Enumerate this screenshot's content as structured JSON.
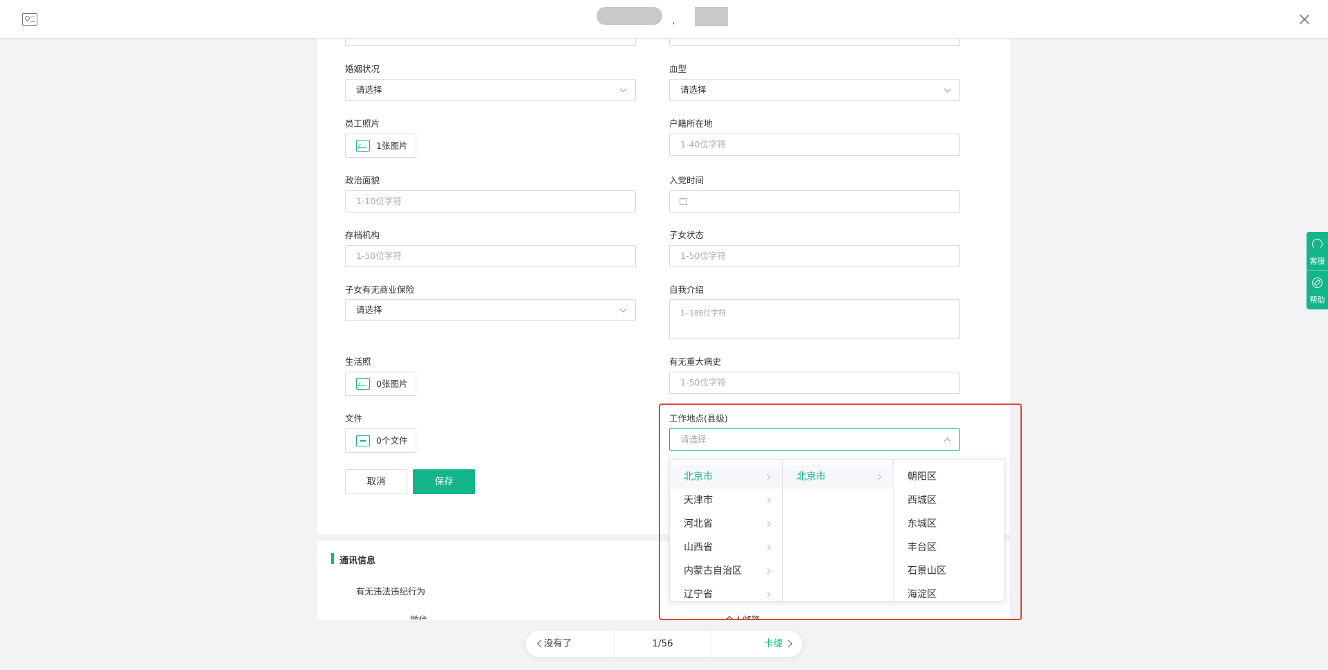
{
  "header": {
    "separator": ","
  },
  "form": {
    "marital": {
      "label": "婚姻状况",
      "value": "请选择"
    },
    "blood": {
      "label": "血型",
      "value": "请选择"
    },
    "photo": {
      "label": "员工照片",
      "count": "1张图片"
    },
    "hukou": {
      "label": "户籍所在地",
      "placeholder": "1-40位字符"
    },
    "political": {
      "label": "政治面貌",
      "placeholder": "1-10位字符"
    },
    "party_date": {
      "label": "入党时间"
    },
    "archive": {
      "label": "存档机构",
      "placeholder": "1-50位字符"
    },
    "children_status": {
      "label": "子女状态",
      "placeholder": "1-50位字符"
    },
    "children_insurance": {
      "label": "子女有无商业保险",
      "value": "请选择"
    },
    "intro": {
      "label": "自我介绍",
      "placeholder": "1~100位字符"
    },
    "life_photo": {
      "label": "生活照",
      "count": "0张图片"
    },
    "illness": {
      "label": "有无重大病史",
      "placeholder": "1-50位字符"
    },
    "file": {
      "label": "文件",
      "count": "0个文件"
    },
    "work_location": {
      "label": "工作地点(县级)",
      "placeholder": "请选择"
    }
  },
  "buttons": {
    "cancel": "取消",
    "save": "保存"
  },
  "section": {
    "title": "通讯信息",
    "sub_label": "有无违法违纪行为",
    "cut_left": "微信",
    "cut_right": "个人邮箱"
  },
  "cascader": {
    "provinces": [
      "北京市",
      "天津市",
      "河北省",
      "山西省",
      "内蒙古自治区",
      "辽宁省"
    ],
    "cities": [
      "北京市"
    ],
    "districts": [
      "朝阳区",
      "西城区",
      "东城区",
      "丰台区",
      "石景山区",
      "海淀区"
    ]
  },
  "side_toolbar": {
    "service": "客服",
    "help": "帮助"
  },
  "pager": {
    "prev": "没有了",
    "position": "1/56",
    "next": "卡缇"
  },
  "colors": {
    "accent": "#13b58a",
    "highlight_box": "#e8412c"
  }
}
